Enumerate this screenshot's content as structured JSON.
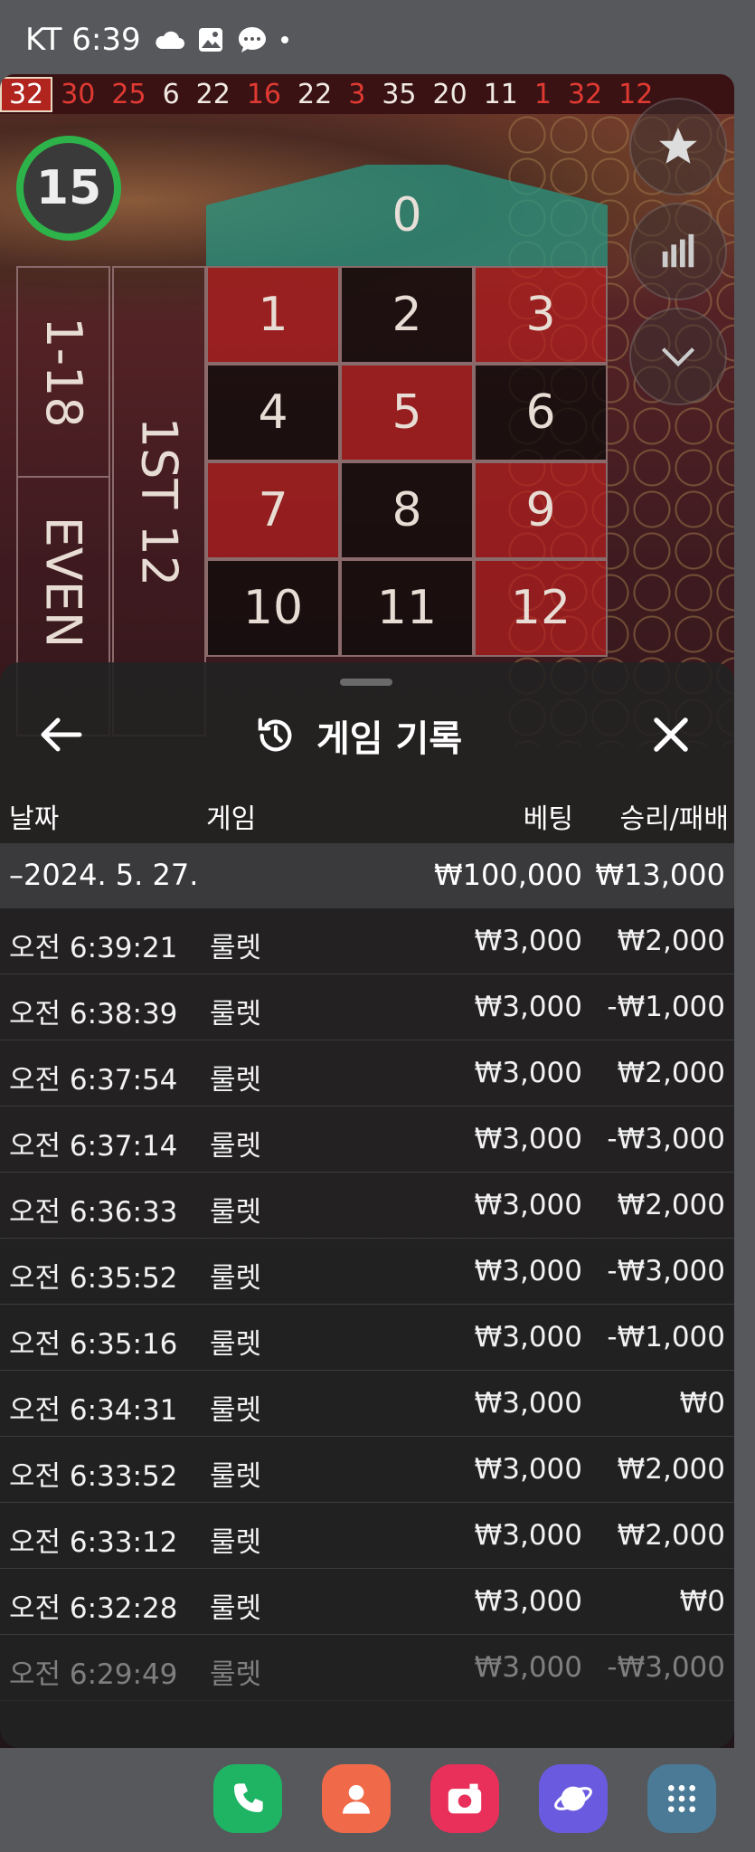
{
  "status": {
    "carrier": "KT 6:39"
  },
  "ticker": [
    {
      "n": "32",
      "c": "red"
    },
    {
      "n": "30",
      "c": "red"
    },
    {
      "n": "25",
      "c": "red"
    },
    {
      "n": "6",
      "c": "blk"
    },
    {
      "n": "22",
      "c": "blk"
    },
    {
      "n": "16",
      "c": "red"
    },
    {
      "n": "22",
      "c": "blk"
    },
    {
      "n": "3",
      "c": "red"
    },
    {
      "n": "35",
      "c": "blk"
    },
    {
      "n": "20",
      "c": "blk"
    },
    {
      "n": "11",
      "c": "blk"
    },
    {
      "n": "1",
      "c": "red"
    },
    {
      "n": "32",
      "c": "red"
    },
    {
      "n": "12",
      "c": "red"
    }
  ],
  "table": {
    "timer": "15",
    "zero": "0",
    "side_top": "1-18",
    "side_bottom": "EVEN",
    "dozen": "1ST 12",
    "cells": [
      [
        {
          "n": "1",
          "c": "red"
        },
        {
          "n": "2",
          "c": "blk"
        },
        {
          "n": "3",
          "c": "red"
        }
      ],
      [
        {
          "n": "4",
          "c": "blk"
        },
        {
          "n": "5",
          "c": "red"
        },
        {
          "n": "6",
          "c": "blk"
        }
      ],
      [
        {
          "n": "7",
          "c": "red"
        },
        {
          "n": "8",
          "c": "blk"
        },
        {
          "n": "9",
          "c": "red"
        }
      ],
      [
        {
          "n": "10",
          "c": "blk"
        },
        {
          "n": "11",
          "c": "blk"
        },
        {
          "n": "12",
          "c": "red"
        }
      ]
    ]
  },
  "sheet": {
    "title": "게임 기록",
    "columns": {
      "date": "날짜",
      "game": "게임",
      "bet": "베팅",
      "result": "승리/패배"
    },
    "summary": {
      "date": "–2024. 5. 27.",
      "bet": "₩100,000",
      "result": "₩13,000"
    },
    "rows": [
      {
        "time": "오전 6:39:21",
        "game": "룰렛",
        "bet": "₩3,000",
        "result": "₩2,000"
      },
      {
        "time": "오전 6:38:39",
        "game": "룰렛",
        "bet": "₩3,000",
        "result": "-₩1,000"
      },
      {
        "time": "오전 6:37:54",
        "game": "룰렛",
        "bet": "₩3,000",
        "result": "₩2,000"
      },
      {
        "time": "오전 6:37:14",
        "game": "룰렛",
        "bet": "₩3,000",
        "result": "-₩3,000"
      },
      {
        "time": "오전 6:36:33",
        "game": "룰렛",
        "bet": "₩3,000",
        "result": "₩2,000"
      },
      {
        "time": "오전 6:35:52",
        "game": "룰렛",
        "bet": "₩3,000",
        "result": "-₩3,000"
      },
      {
        "time": "오전 6:35:16",
        "game": "룰렛",
        "bet": "₩3,000",
        "result": "-₩1,000"
      },
      {
        "time": "오전 6:34:31",
        "game": "룰렛",
        "bet": "₩3,000",
        "result": "₩0"
      },
      {
        "time": "오전 6:33:52",
        "game": "룰렛",
        "bet": "₩3,000",
        "result": "₩2,000"
      },
      {
        "time": "오전 6:33:12",
        "game": "룰렛",
        "bet": "₩3,000",
        "result": "₩2,000"
      },
      {
        "time": "오전 6:32:28",
        "game": "룰렛",
        "bet": "₩3,000",
        "result": "₩0"
      },
      {
        "time": "오전 6:29:49",
        "game": "룰렛",
        "bet": "₩3,000",
        "result": "-₩3,000"
      }
    ]
  },
  "dock": [
    {
      "name": "phone-app-icon",
      "color": "#1fb463"
    },
    {
      "name": "contacts-app-icon",
      "color": "#f06a4a"
    },
    {
      "name": "camera-app-icon",
      "color": "#e8305a"
    },
    {
      "name": "internet-app-icon",
      "color": "#6a5ae0"
    },
    {
      "name": "apps-drawer-icon",
      "color": "#4a7a96"
    }
  ]
}
